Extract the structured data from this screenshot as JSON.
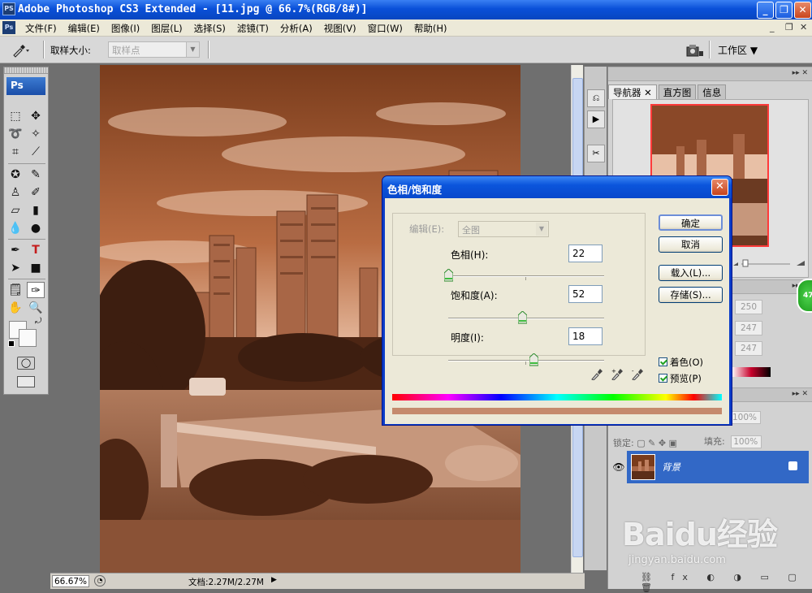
{
  "window": {
    "app_icon": "PS",
    "title": "Adobe Photoshop CS3 Extended - [11.jpg @ 66.7%(RGB/8#)]",
    "min_glyph": "_",
    "max_glyph": "❐",
    "close_glyph": "✕"
  },
  "menubar": {
    "doc_icon": "Ps",
    "items": [
      "文件(F)",
      "编辑(E)",
      "图像(I)",
      "图层(L)",
      "选择(S)",
      "滤镜(T)",
      "分析(A)",
      "视图(V)",
      "窗口(W)",
      "帮助(H)"
    ],
    "mdi_min": "_",
    "mdi_restore": "❐",
    "mdi_close": "✕"
  },
  "options_bar": {
    "sample_size_label": "取样大小:",
    "sample_size_value": "取样点",
    "workspace_label": "工作区 ▼"
  },
  "toolbox": {
    "logo": "Ps"
  },
  "status_bar": {
    "zoom": "66.67%",
    "doc_info": "文档:2.27M/2.27M",
    "arrow": "▶"
  },
  "panels": {
    "nav_tabs": [
      "导航器",
      "直方图",
      "信息"
    ],
    "nav_tab_close": "✕",
    "info_values": [
      "250",
      "247",
      "247"
    ],
    "opacity_value": "100%",
    "lock_label": "锁定:",
    "fill_label": "填充:",
    "fill_value": "100%",
    "layer_name": "背景",
    "eye_glyph": "👁",
    "badge": "47"
  },
  "dialog": {
    "title": "色相/饱和度",
    "close_glyph": "✕",
    "edit_label": "编辑(E):",
    "edit_value": "全图",
    "hue_label": "色相(H):",
    "hue_value": "22",
    "saturation_label": "饱和度(A):",
    "saturation_value": "52",
    "lightness_label": "明度(I):",
    "lightness_value": "18",
    "ok_label": "确定",
    "cancel_label": "取消",
    "load_label": "载入(L)...",
    "save_label": "存储(S)...",
    "colorize_label": "着色(O)",
    "colorize_checked": true,
    "preview_label": "预览(P)",
    "preview_checked": true
  },
  "watermark": {
    "brand": "Baidu经验",
    "url": "jingyan.baidu.com"
  },
  "colors": {
    "sepia_tone": "#c58a6d",
    "selected_layer": "#3268c6",
    "xp_titlebar": "#0a50d8"
  }
}
